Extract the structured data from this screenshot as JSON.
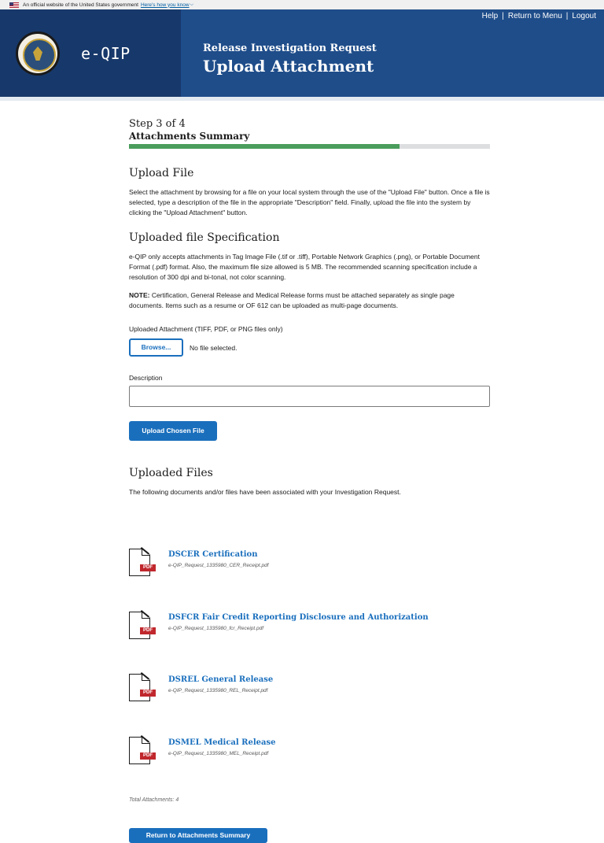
{
  "gov_banner": {
    "text": "An official website of the United States government",
    "link": "Here's how you know"
  },
  "header": {
    "brand": "e-QIP",
    "subtitle": "Release Investigation Request",
    "title": "Upload Attachment",
    "links": [
      "Help",
      "Return to Menu",
      "Logout"
    ],
    "colors": {
      "header_bg": "#1f4d8a",
      "brand_panel_bg": "#17386a"
    }
  },
  "step": {
    "label": "Step 3 of 4",
    "title": "Attachments Summary",
    "progress": 0.75,
    "progress_color": "#4a9d5c"
  },
  "upload_section": {
    "heading": "Upload File",
    "text": "Select the attachment by browsing for a file on your local system through the use of the \"Upload File\" button. Once a file is selected, type a description of the file in the appropriate \"Description\" field. Finally, upload the file into the system by clicking the \"Upload Attachment\" button."
  },
  "spec_section": {
    "heading": "Uploaded file Specification",
    "text": "e-QIP only accepts attachments in Tag Image File (.tif or .tiff), Portable Network Graphics (.png), or Portable Document Format (.pdf) format. Also, the maximum file size allowed is 5 MB. The recommended scanning specification include a resolution of 300 dpi and bi-tonal, not color scanning.",
    "note_label": "NOTE:",
    "note_text": " Certification, General Release and Medical Release forms must be attached separately as single page documents. Items such as a resume or OF 612 can be uploaded as multi-page documents."
  },
  "form": {
    "attachment_label": "Uploaded Attachment (TIFF, PDF, or PNG files only)",
    "browse_label": "Browse...",
    "no_file_text": "No file selected.",
    "description_label": "Description",
    "description_value": "",
    "upload_button": "Upload Chosen File"
  },
  "uploaded_files": {
    "heading": "Uploaded Files",
    "intro": "The following documents and/or files have been associated with your Investigation Request.",
    "files": [
      {
        "title": "DSCER Certification",
        "filename": "e-QIP_Request_1335980_CER_Receipt.pdf",
        "icon": "pdf-document-icon",
        "badge": "PDF"
      },
      {
        "title": "DSFCR Fair Credit Reporting Disclosure and Authorization",
        "filename": "e-QIP_Request_1335980_fcr_Receipt.pdf",
        "icon": "pdf-document-icon",
        "badge": "PDF"
      },
      {
        "title": "DSREL General Release",
        "filename": "e-QIP_Request_1335980_REL_Receipt.pdf",
        "icon": "pdf-document-icon",
        "badge": "PDF"
      },
      {
        "title": "DSMEL Medical Release",
        "filename": "e-QIP_Request_1335980_MEL_Receipt.pdf",
        "icon": "pdf-document-icon",
        "badge": "PDF"
      }
    ],
    "total": "Total Attachments: 4"
  },
  "footer": {
    "return_button": "Return to Attachments Summary"
  },
  "accent_color": "#1a6fbd"
}
